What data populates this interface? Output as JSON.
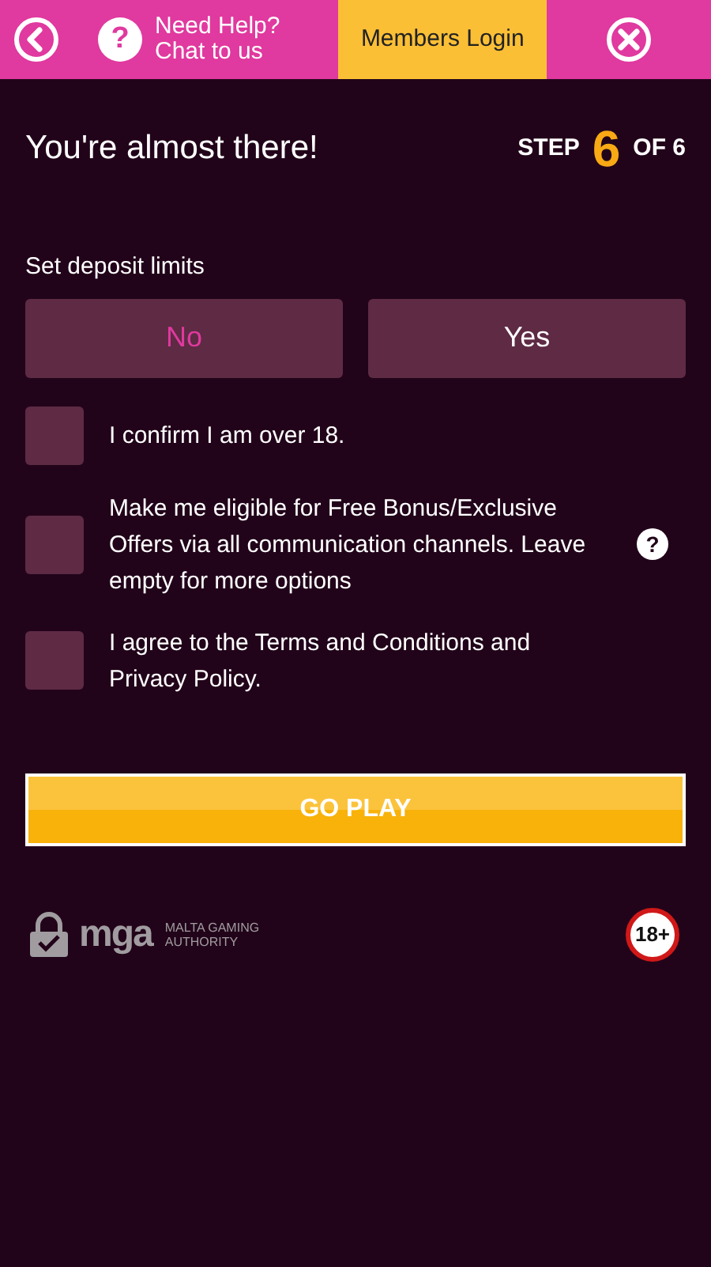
{
  "header": {
    "help_icon_text": "?",
    "help_text": [
      "Need Help?",
      "Chat to us"
    ],
    "login_button": "Members Login"
  },
  "title": "You're almost there!",
  "step": {
    "label": "STEP",
    "current": "6",
    "of": "OF 6"
  },
  "deposit_limits": {
    "label": "Set deposit limits",
    "options": [
      {
        "label": "No",
        "selected": true
      },
      {
        "label": "Yes",
        "selected": false
      }
    ]
  },
  "consents": [
    {
      "checked": false,
      "segments": [
        {
          "kind": "text",
          "text": "I confirm I am over 18."
        }
      ]
    },
    {
      "checked": false,
      "info": "?",
      "segments": [
        {
          "kind": "text",
          "text": "Make me eligible for Free Bonus/Exclusive Offers via all communication channels. Leave empty for more options"
        }
      ]
    },
    {
      "checked": false,
      "segments": [
        {
          "kind": "text",
          "text": "I agree to the "
        },
        {
          "kind": "link",
          "text": "Terms and Conditions"
        },
        {
          "kind": "text",
          "text": " and "
        },
        {
          "kind": "link",
          "text": "Privacy Policy"
        },
        {
          "kind": "text",
          "text": "."
        }
      ]
    }
  ],
  "submit": "GO PLAY",
  "footer": {
    "regulator_mark": "mga",
    "regulator_name": [
      "MALTA GAMING",
      "AUTHORITY"
    ],
    "age_badge": "18+"
  }
}
